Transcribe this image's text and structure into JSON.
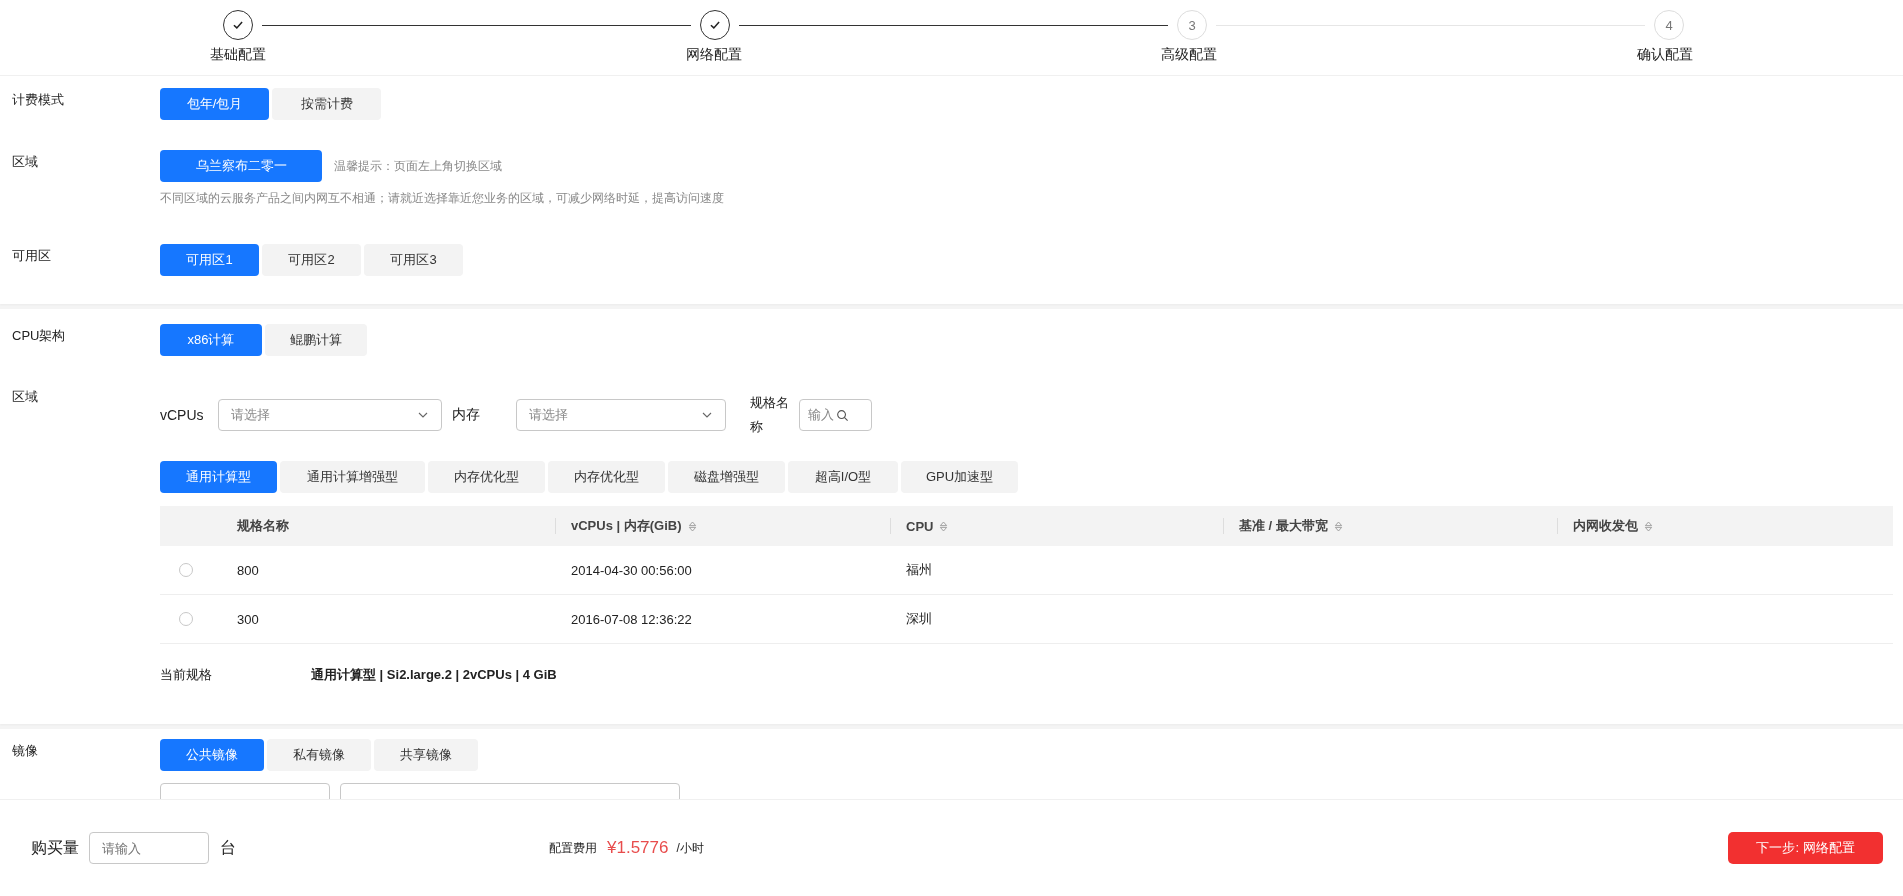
{
  "steps": [
    {
      "label": "基础配置",
      "done": true
    },
    {
      "label": "网络配置",
      "done": true
    },
    {
      "number": "3",
      "label": "高级配置",
      "done": false
    },
    {
      "number": "4",
      "label": "确认配置",
      "done": false
    }
  ],
  "billing": {
    "label": "计费模式",
    "options": [
      {
        "label": "包年/包月",
        "selected": true
      },
      {
        "label": "按需计费",
        "selected": false
      }
    ]
  },
  "region": {
    "label": "区域",
    "value": "乌兰察布二零一",
    "tip": "温馨提示：页面左上角切换区域",
    "note": "不同区域的云服务产品之间内网互不相通；请就近选择靠近您业务的区域，可减少网络时延，提高访问速度"
  },
  "zone": {
    "label": "可用区",
    "options": [
      {
        "label": "可用区1",
        "selected": true
      },
      {
        "label": "可用区2",
        "selected": false
      },
      {
        "label": "可用区3",
        "selected": false
      }
    ]
  },
  "cpu_arch": {
    "label": "CPU架构",
    "options": [
      {
        "label": "x86计算",
        "selected": true
      },
      {
        "label": "鲲鹏计算",
        "selected": false
      }
    ]
  },
  "spec": {
    "label": "区域",
    "vcpus_label": "vCPUs",
    "vcpus_placeholder": "请选择",
    "memory_label": "内存",
    "memory_placeholder": "请选择",
    "name_label": "规格名称",
    "name_placeholder": "输入",
    "tabs": [
      {
        "label": "通用计算型",
        "selected": true
      },
      {
        "label": "通用计算增强型",
        "selected": false
      },
      {
        "label": "内存优化型",
        "selected": false
      },
      {
        "label": "内存优化型",
        "selected": false
      },
      {
        "label": "磁盘增强型",
        "selected": false
      },
      {
        "label": "超高I/O型",
        "selected": false
      },
      {
        "label": "GPU加速型",
        "selected": false
      }
    ],
    "table": {
      "columns": [
        {
          "label": "规格名称",
          "sortable": false
        },
        {
          "label": "vCPUs | 内存(GiB)",
          "sortable": true
        },
        {
          "label": "CPU",
          "sortable": true
        },
        {
          "label": "基准 / 最大带宽",
          "sortable": true
        },
        {
          "label": "内网收发包",
          "sortable": true
        }
      ],
      "rows": [
        {
          "selected": false,
          "cells": [
            "800",
            "2014-04-30 00:56:00",
            "福州"
          ]
        },
        {
          "selected": false,
          "cells": [
            "300",
            "2016-07-08 12:36:22",
            "深圳"
          ]
        }
      ]
    },
    "current_label": "当前规格",
    "current_value": "通用计算型 | Si2.large.2 | 2vCPUs | 4 GiB"
  },
  "image": {
    "label": "镜像",
    "options": [
      {
        "label": "公共镜像",
        "selected": true
      },
      {
        "label": "私有镜像",
        "selected": false
      },
      {
        "label": "共享镜像",
        "selected": false
      }
    ]
  },
  "footer": {
    "quantity_label": "购买量",
    "quantity_placeholder": "请输入",
    "unit": "台",
    "fee_label": "配置费用",
    "price": "¥1.5776",
    "price_unit": "/小时",
    "next_button": "下一步: 网络配置"
  }
}
